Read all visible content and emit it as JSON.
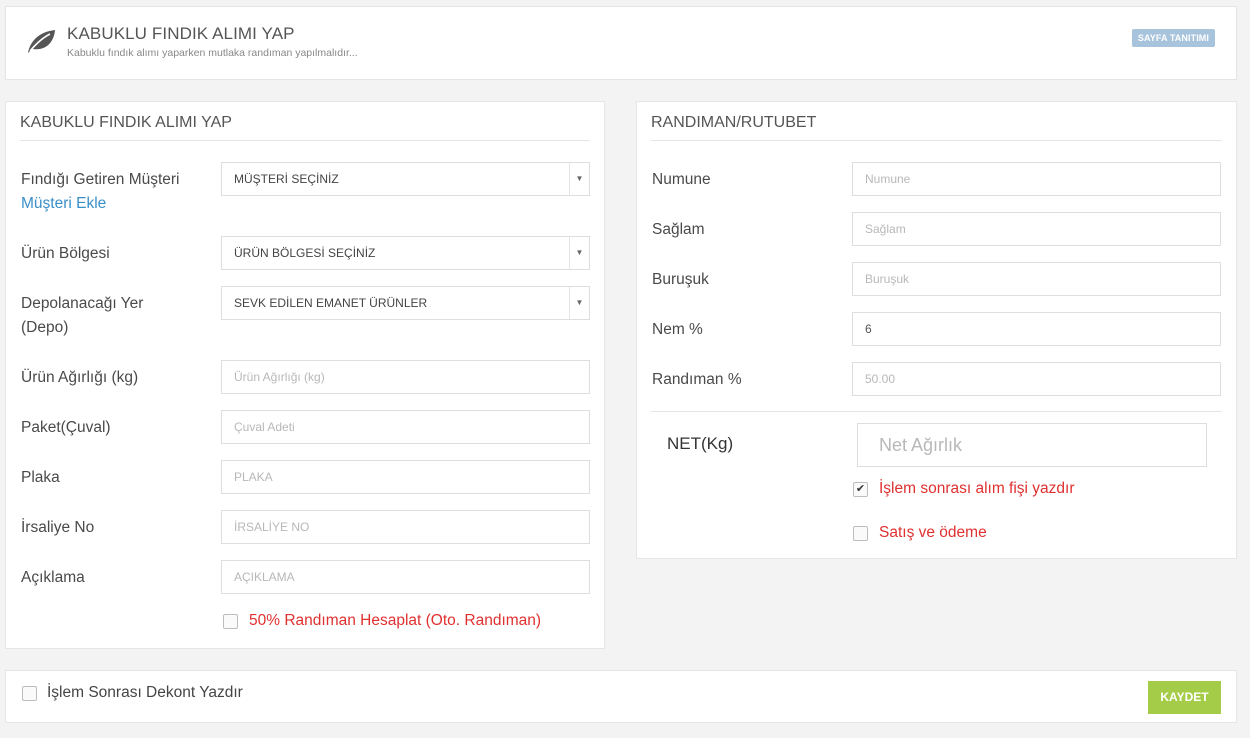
{
  "header": {
    "title": "KABUKLU FINDIK ALIMI YAP",
    "subtitle": "Kabuklu fındık alımı yaparken mutlaka randıman yapılmalıdır...",
    "badge": "SAYFA TANITIMI",
    "icon": "leaf-icon"
  },
  "left_panel": {
    "title": "KABUKLU FINDIK ALIMI YAP",
    "customer_label": "Fındığı Getiren Müşteri",
    "add_customer_link": "Müşteri Ekle",
    "customer_select": "MÜŞTERİ SEÇİNİZ",
    "region_label": "Ürün Bölgesi",
    "region_select": "ÜRÜN BÖLGESİ SEÇİNİZ",
    "depot_label_line1": "Depolanacağı Yer",
    "depot_label_line2": "(Depo)",
    "depot_select": "SEVK EDİLEN EMANET ÜRÜNLER",
    "weight_label": "Ürün Ağırlığı (kg)",
    "weight_placeholder": "Ürün Ağırlığı (kg)",
    "package_label": "Paket(Çuval)",
    "package_placeholder": "Çuval Adeti",
    "plate_label": "Plaka",
    "plate_placeholder": "PLAKA",
    "waybill_label": "İrsaliye No",
    "waybill_placeholder": "İRSALİYE NO",
    "note_label": "Açıklama",
    "note_placeholder": "AÇIKLAMA",
    "auto_yield_label": "50% Randıman Hesaplat (Oto. Randıman)",
    "auto_yield_checked": false
  },
  "right_panel": {
    "title": "RANDIMAN/RUTUBET",
    "sample_label": "Numune",
    "sample_placeholder": "Numune",
    "sound_label": "Sağlam",
    "sound_placeholder": "Sağlam",
    "wrinkled_label": "Buruşuk",
    "wrinkled_placeholder": "Buruşuk",
    "moisture_label": "Nem %",
    "moisture_value": "6",
    "yield_label": "Randıman %",
    "yield_placeholder": "50.00",
    "net_label": "NET(Kg)",
    "net_placeholder": "Net Ağırlık",
    "print_receipt_label": "İşlem sonrası alım fişi yazdır",
    "print_receipt_checked": true,
    "sale_payment_label": "Satış ve ödeme",
    "sale_payment_checked": false
  },
  "footer": {
    "print_receipt_label": "İşlem Sonrası Dekont Yazdır",
    "print_receipt_checked": false,
    "save_button": "KAYDET"
  },
  "colors": {
    "accent_link": "#3a8fc8",
    "checkbox_label_red": "#e03030",
    "save_button": "#a4cc48",
    "badge": "#a8c3dc"
  }
}
